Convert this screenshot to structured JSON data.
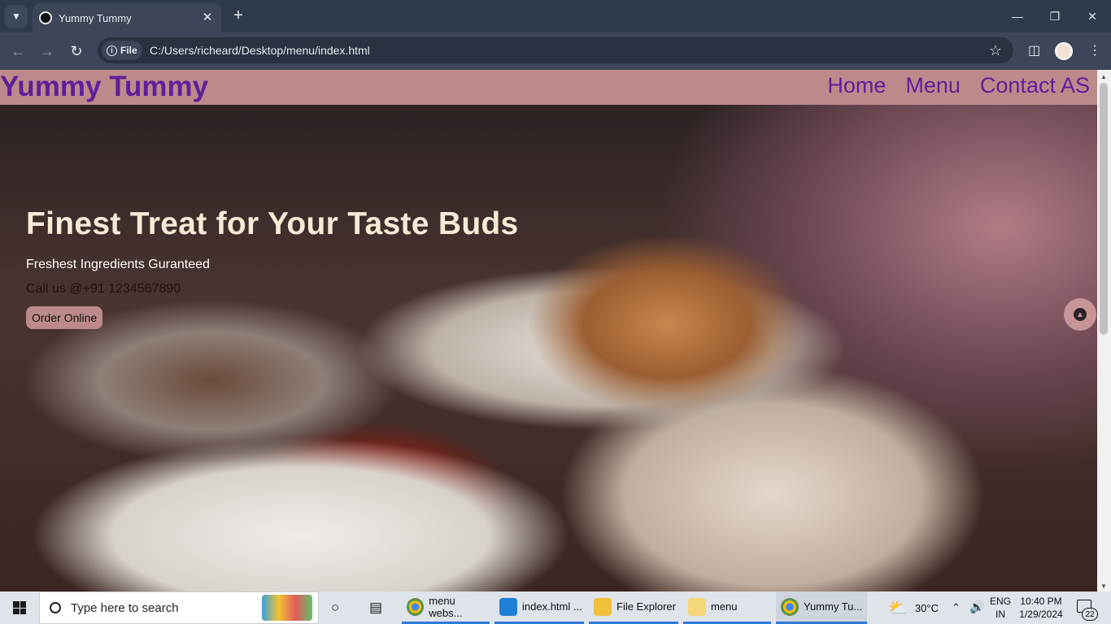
{
  "browser": {
    "tab_title": "Yummy Tummy",
    "url_chip": "File",
    "url": "C:/Users/richeard/Desktop/menu/index.html"
  },
  "site": {
    "brand": "Yummy Tummy",
    "nav": [
      "Home",
      "Menu",
      "Contact AS"
    ]
  },
  "hero": {
    "heading": "Finest Treat for Your Taste Buds",
    "tagline": "Freshest Ingredients Guranteed",
    "call": "Call us @+91 1234567890",
    "order_button": "Order Online"
  },
  "taskbar": {
    "search_placeholder": "Type here to search",
    "apps": [
      {
        "label": "menu webs...",
        "icon": "chrome-icon"
      },
      {
        "label": "index.html ...",
        "icon": "vscode-icon"
      },
      {
        "label": "File Explorer",
        "icon": "folder-icon"
      },
      {
        "label": "menu",
        "icon": "folder-icon"
      },
      {
        "label": "Yummy Tu...",
        "icon": "chrome-icon"
      }
    ],
    "weather": "30°C",
    "language": [
      "ENG",
      "IN"
    ],
    "time": "10:40 PM",
    "date": "1/29/2024",
    "notifications": "22"
  },
  "colors": {
    "navbar_bg": "#bd8a8c",
    "brand_color": "#5e1f9a",
    "heading_color": "#f8ead6",
    "accent": "#2f7ad6"
  }
}
